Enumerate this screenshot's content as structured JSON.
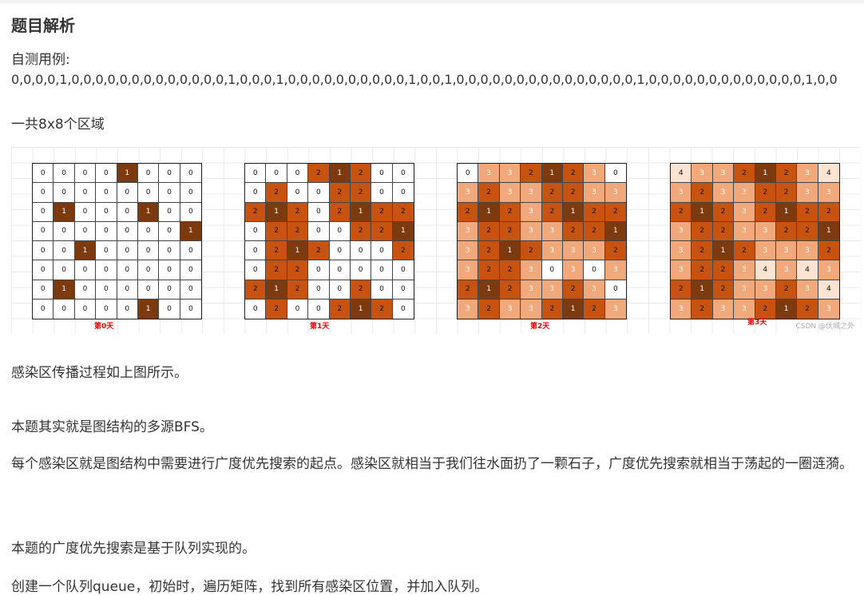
{
  "heading": "题目解析",
  "test_label": "自测用例:",
  "sequence": "0,0,0,0,1,0,0,0,0,0,0,0,0,0,0,0,0,0,1,0,0,0,1,0,0,0,0,0,0,0,0,0,0,1,0,0,1,0,0,0,0,0,0,0,0,0,0,0,0,0,0,0,1,0,0,0,0,0,0,0,0,0,0,0,0,0,1,0,0",
  "regions_text": "一共8x8个区域",
  "figure": {
    "watermark": "CSDN @伏城之外",
    "colors": {
      "1": "#7d3a0e",
      "2": "#c8520f",
      "3": "#f1a87b",
      "4": "#fce3d2",
      "0": "#ffffff"
    },
    "days": [
      {
        "label": "第0天",
        "cells": [
          [
            0,
            0,
            0,
            0,
            1,
            0,
            0,
            0
          ],
          [
            0,
            0,
            0,
            0,
            0,
            0,
            0,
            0
          ],
          [
            0,
            1,
            0,
            0,
            0,
            1,
            0,
            0
          ],
          [
            0,
            0,
            0,
            0,
            0,
            0,
            0,
            1
          ],
          [
            0,
            0,
            1,
            0,
            0,
            0,
            0,
            0
          ],
          [
            0,
            0,
            0,
            0,
            0,
            0,
            0,
            0
          ],
          [
            0,
            1,
            0,
            0,
            0,
            0,
            0,
            0
          ],
          [
            0,
            0,
            0,
            0,
            0,
            1,
            0,
            0
          ]
        ]
      },
      {
        "label": "第1天",
        "cells": [
          [
            0,
            0,
            0,
            2,
            1,
            2,
            0,
            0
          ],
          [
            0,
            2,
            0,
            0,
            2,
            2,
            0,
            0
          ],
          [
            2,
            1,
            2,
            0,
            2,
            1,
            2,
            2
          ],
          [
            0,
            2,
            2,
            0,
            0,
            2,
            2,
            1
          ],
          [
            0,
            2,
            1,
            2,
            0,
            0,
            0,
            2
          ],
          [
            0,
            2,
            2,
            0,
            0,
            0,
            0,
            0
          ],
          [
            2,
            1,
            2,
            0,
            0,
            2,
            0,
            0
          ],
          [
            0,
            2,
            0,
            0,
            2,
            1,
            2,
            0
          ]
        ]
      },
      {
        "label": "第2天",
        "cells": [
          [
            0,
            3,
            3,
            2,
            1,
            2,
            3,
            0
          ],
          [
            3,
            2,
            3,
            3,
            2,
            2,
            3,
            3
          ],
          [
            2,
            1,
            2,
            3,
            2,
            1,
            2,
            2
          ],
          [
            3,
            2,
            2,
            3,
            3,
            2,
            2,
            1
          ],
          [
            3,
            2,
            1,
            2,
            3,
            3,
            3,
            2
          ],
          [
            3,
            2,
            2,
            3,
            0,
            3,
            0,
            3
          ],
          [
            2,
            1,
            2,
            3,
            3,
            2,
            3,
            0
          ],
          [
            3,
            2,
            3,
            3,
            2,
            1,
            2,
            3
          ]
        ]
      },
      {
        "label": "第3天",
        "cells": [
          [
            4,
            3,
            3,
            2,
            1,
            2,
            3,
            4
          ],
          [
            3,
            2,
            3,
            3,
            2,
            2,
            3,
            3
          ],
          [
            2,
            1,
            2,
            3,
            2,
            1,
            2,
            2
          ],
          [
            3,
            2,
            2,
            3,
            3,
            2,
            2,
            1
          ],
          [
            3,
            2,
            1,
            2,
            3,
            3,
            3,
            2
          ],
          [
            3,
            2,
            2,
            3,
            4,
            3,
            4,
            3
          ],
          [
            2,
            1,
            2,
            3,
            3,
            2,
            3,
            4
          ],
          [
            3,
            2,
            3,
            3,
            2,
            1,
            2,
            3
          ]
        ]
      }
    ]
  },
  "paragraphs": [
    " 感染区传播过程如上图所示。",
    "本题其实就是图结构的多源BFS。",
    "每个感染区就是图结构中需要进行广度优先搜索的起点。感染区就相当于我们往水面扔了一颗石子，广度优先搜索就相当于荡起的一圈涟漪。",
    "本题的广度优先搜索是基于队列实现的。",
    "创建一个队列queue，初始时，遍历矩阵，找到所有感染区位置，并加入队列。"
  ]
}
